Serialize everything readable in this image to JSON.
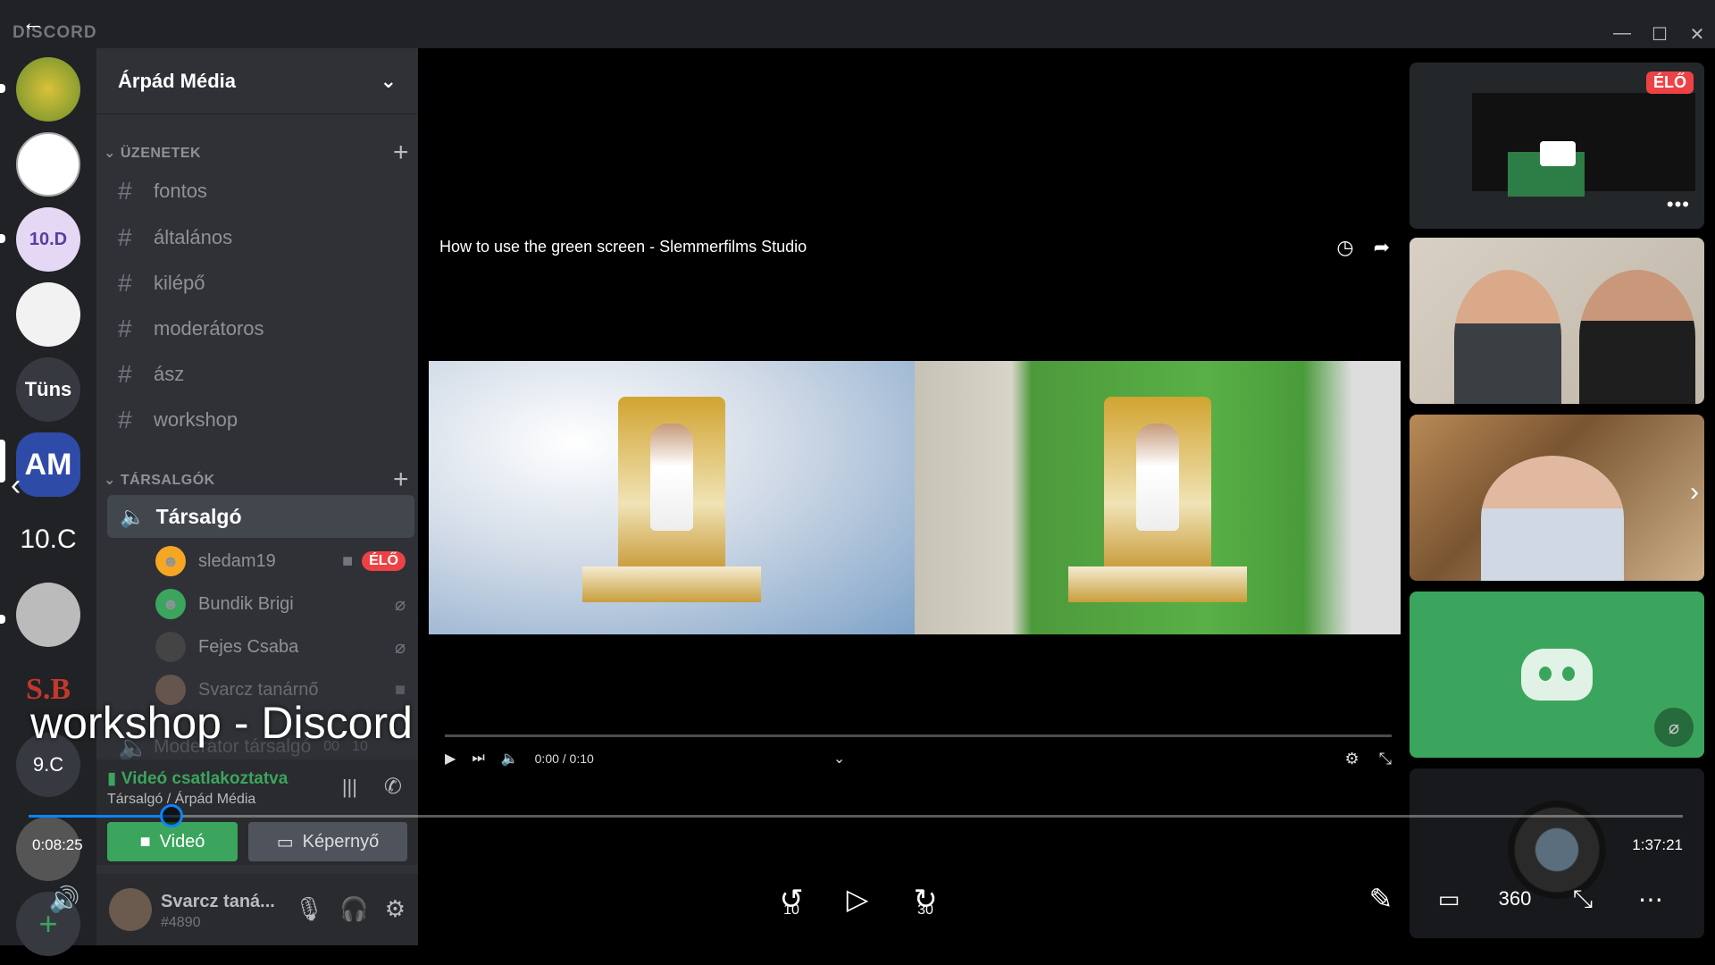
{
  "window": {
    "app_logo": "DISCORD",
    "minimize": "—",
    "maximize": "☐",
    "close": "✕"
  },
  "servers": [
    {
      "label": "",
      "color": "#7fa33a"
    },
    {
      "label": "",
      "color": "#e9e0f2"
    },
    {
      "label": "10.D",
      "color": "#d7c9ef"
    },
    {
      "label": "",
      "color": "#f0f0f0"
    },
    {
      "label": "Tüns",
      "color": "#36393f"
    },
    {
      "label": "AM",
      "color": "#2f4ba8"
    },
    {
      "label": "10.C",
      "color": "#202225"
    },
    {
      "label": "",
      "color": "#5a5a5a"
    },
    {
      "label": "S.B",
      "color": "#202225"
    },
    {
      "label": "9.C",
      "color": "#36393f"
    }
  ],
  "sidebar": {
    "server_name": "Árpád Média",
    "text_category": "ÜZENETEK",
    "text_channels": [
      "fontos",
      "általános",
      "kilépő",
      "moderátoros",
      "ász",
      "workshop"
    ],
    "voice_category": "TÁRSALGÓK",
    "voice_channel": "Társalgó",
    "members": [
      {
        "name": "sledam19",
        "live": "ÉLŐ",
        "avatar_color": "#f5a623"
      },
      {
        "name": "Bundik Brigi",
        "avatar_color": "#3ba55d"
      },
      {
        "name": "Fejes Csaba",
        "avatar_color": "#444"
      },
      {
        "name": "Svarcz tanárnő",
        "avatar_color": "#8a6e5c"
      }
    ],
    "other_voice_channel": "Moderátor társalgó",
    "other_voice_counts": [
      "00",
      "10"
    ]
  },
  "voice_panel": {
    "status": "Videó csatlakoztatva",
    "location": "Társalgó / Árpád Média",
    "video_label": "Videó",
    "screen_label": "Képernyő"
  },
  "user_panel": {
    "name": "Svarcz taná...",
    "tag": "#4890"
  },
  "stage": {
    "video_title": "How to use the green screen - Slemmerfilms Studio",
    "time": "0:00 / 0:10"
  },
  "tiles": {
    "live_badge": "ÉLŐ"
  },
  "player": {
    "title": "workshop - Discord",
    "current_time": "0:08:25",
    "duration": "1:37:21",
    "progress": 0.0866,
    "skip_back": "10",
    "skip_forward": "30",
    "vr_label": "360"
  },
  "colors": {
    "accent": "#0a84ff",
    "green": "#3ba55d",
    "live": "#ed4245"
  }
}
